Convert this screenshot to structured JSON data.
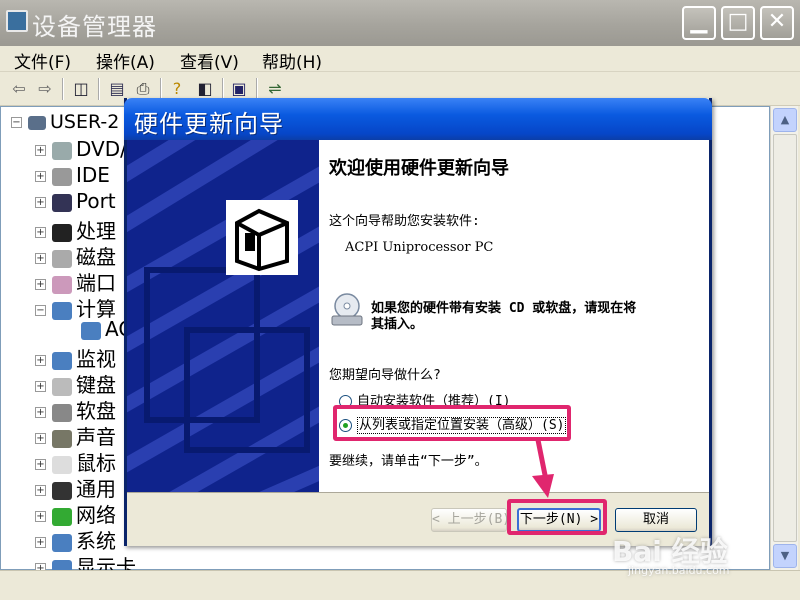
{
  "device_manager": {
    "title": "设备管理器",
    "menu": [
      "文件(F)",
      "操作(A)",
      "查看(V)",
      "帮助(H)"
    ],
    "tree_root": "USER-2",
    "nodes": [
      "DVD/",
      "IDE",
      "Port",
      "处理",
      "磁盘",
      "端口",
      "计算",
      "监视",
      "键盘",
      "软盘",
      "声音",
      "鼠标",
      "通用",
      "网络",
      "系统",
      "显示卡"
    ],
    "child": "AC"
  },
  "wizard": {
    "title": "硬件更新向导",
    "heading": "欢迎使用硬件更新向导",
    "intro": "这个向导帮助您安装软件:",
    "device": "ACPI Uniprocessor PC",
    "cd_line1": "如果您的硬件带有安装 CD 或软盘，请现在将",
    "cd_line2": "其插入。",
    "question": "您期望向导做什么?",
    "options": [
      {
        "label": "自动安装软件（推荐）(I)",
        "selected": false
      },
      {
        "label": "从列表或指定位置安装（高级）(S)",
        "selected": true
      }
    ],
    "continue": "要继续，请单击“下一步”。",
    "buttons": {
      "back": "< 上一步(B)",
      "next": "下一步(N) >",
      "cancel": "取消"
    }
  },
  "watermark": {
    "brand": "Bai 经验",
    "url": "jingyan.baidu.com"
  },
  "colors": {
    "highlight": "#e0266e",
    "wizard_title": "#0a5ae0",
    "sidebar": "#0f238c"
  }
}
